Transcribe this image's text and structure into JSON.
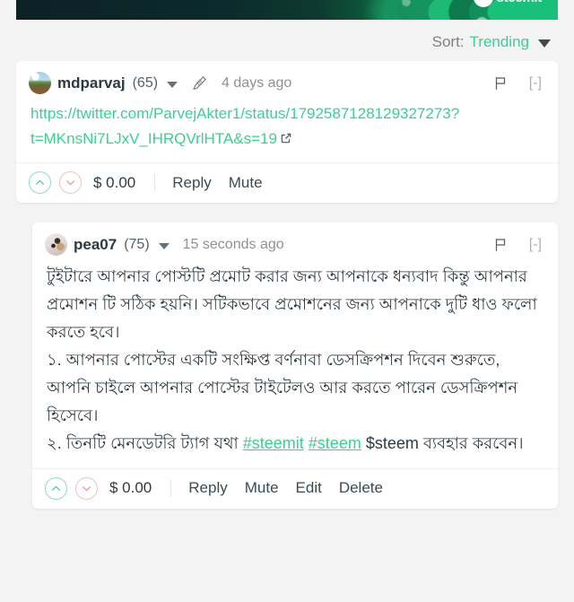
{
  "banner": {
    "logo_name": "steemit-logo-icon",
    "wordmark": "steemit"
  },
  "sort": {
    "label": "Sort:",
    "value": "Trending",
    "caret_icon": "chevron-down-icon"
  },
  "comments": [
    {
      "author": "mdparvaj",
      "reputation": "(65)",
      "avatar_name": "avatar-mdparvaj",
      "edited_icon": "pencil-icon",
      "timestamp": "4 days ago",
      "flag_icon": "flag-icon",
      "collapse_toggle": "[-]",
      "body_type": "link",
      "link_text": "https://twitter.com/ParvejAkter1/status/1792587128129327273?t=MKnsNi7LJxV_IHRQVrlHTA&s=19",
      "external_icon": "external-link-icon",
      "upvote_icon": "chevron-up-circle-icon",
      "downvote_icon": "chevron-down-circle-icon",
      "payout": "$ 0.00",
      "actions": [
        "Reply",
        "Mute"
      ]
    },
    {
      "author": "pea07",
      "reputation": "(75)",
      "avatar_name": "avatar-pea07",
      "timestamp": "15 seconds ago",
      "flag_icon": "flag-icon",
      "collapse_toggle": "[-]",
      "body_type": "text",
      "paragraphs": [
        "টুইটারে আপনার পোস্টটি প্রমোট করার জন্য আপনাকে ধন্যবাদ কিন্তু আপনার প্রমোশন টি সঠিক হয়নি। সটিকভাবে প্রমোশনের জন্য আপনাকে দুটি ধাও ফলো করতে হবে।",
        "১. আপনার পোস্টের একটি সংক্ষিপ্ত বর্ণনাবা ডেসক্রিপশন দিবেন শুরুতে, আপনি চাইলে আপনার পোস্টের টাইটেলও আর করতে পারেন ডেসক্রিপশন হিসেবে।"
      ],
      "paragraph3": {
        "before": "২. তিনটি মেনডেটরি ট্যাগ যথা ",
        "tag1": "#steemit",
        "tag2": "#steem",
        "after": " $steem ব্যবহার করবেন।"
      },
      "upvote_icon": "chevron-up-circle-icon",
      "downvote_icon": "chevron-down-circle-icon",
      "payout": "$ 0.00",
      "actions": [
        "Reply",
        "Mute",
        "Edit",
        "Delete"
      ]
    }
  ],
  "colors": {
    "accent_green": "#3ccf92",
    "page_bg": "#f3f3f3",
    "card_bg": "#ffffff",
    "text": "#2e3b42"
  }
}
